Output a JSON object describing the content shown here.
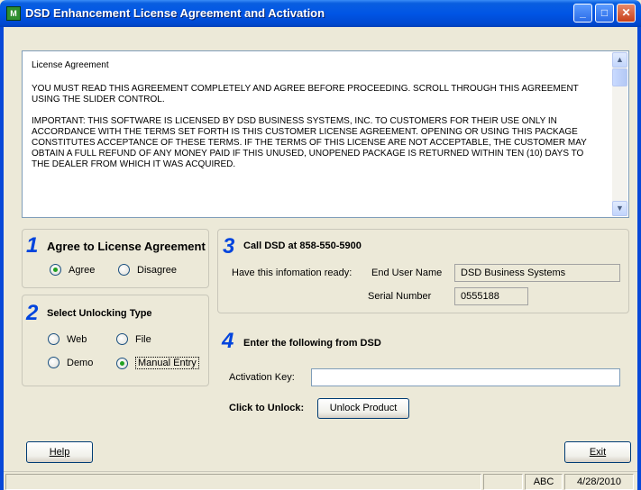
{
  "window": {
    "icon_text": "M",
    "title": "DSD Enhancement License Agreement and Activation",
    "min_glyph": "_",
    "max_glyph": "□",
    "close_glyph": "✕"
  },
  "license": {
    "heading": "License Agreement",
    "paragraph1": "YOU MUST READ THIS AGREEMENT COMPLETELY AND AGREE BEFORE PROCEEDING. SCROLL THROUGH THIS AGREEMENT USING THE SLIDER CONTROL.",
    "paragraph2": "IMPORTANT:  THIS SOFTWARE IS LICENSED BY DSD BUSINESS SYSTEMS, INC. TO CUSTOMERS FOR THEIR USE ONLY IN ACCORDANCE WITH THE TERMS SET FORTH IS THIS CUSTOMER LICENSE AGREEMENT. OPENING OR USING THIS PACKAGE CONSTITUTES ACCEPTANCE OF THESE TERMS.  IF THE TERMS OF THIS LICENSE ARE NOT ACCEPTABLE, THE CUSTOMER MAY OBTAIN A FULL REFUND OF ANY MONEY PAID IF THIS UNUSED, UNOPENED PACKAGE IS RETURNED WITHIN TEN (10) DAYS TO THE DEALER FROM WHICH IT WAS ACQUIRED.",
    "scroll_up_glyph": "▲",
    "scroll_down_glyph": "▼"
  },
  "step1": {
    "number": "1",
    "title": "Agree to License Agreement",
    "options": [
      {
        "label": "Agree",
        "checked": true
      },
      {
        "label": "Disagree",
        "checked": false
      }
    ]
  },
  "step2": {
    "number": "2",
    "title": "Select Unlocking Type",
    "options": [
      {
        "label": "Web",
        "checked": false
      },
      {
        "label": "File",
        "checked": false
      },
      {
        "label": "Demo",
        "checked": false
      },
      {
        "label": "Manual Entry",
        "checked": true
      }
    ]
  },
  "step3": {
    "number": "3",
    "title": "Call DSD at 858-550-5900",
    "info_label": "Have this infomation ready:",
    "end_user_label": "End User Name",
    "end_user_value": "DSD Business Systems",
    "serial_label": "Serial Number",
    "serial_value": "0555188"
  },
  "step4": {
    "number": "4",
    "title": "Enter the following from DSD",
    "activation_label": "Activation Key:",
    "activation_value": "",
    "unlock_label": "Click to Unlock:",
    "unlock_button": "Unlock Product"
  },
  "footer": {
    "help_button": "Help",
    "exit_button": "Exit"
  },
  "status": {
    "cell1": "",
    "cell2": "",
    "mode": "ABC",
    "date": "4/28/2010"
  }
}
